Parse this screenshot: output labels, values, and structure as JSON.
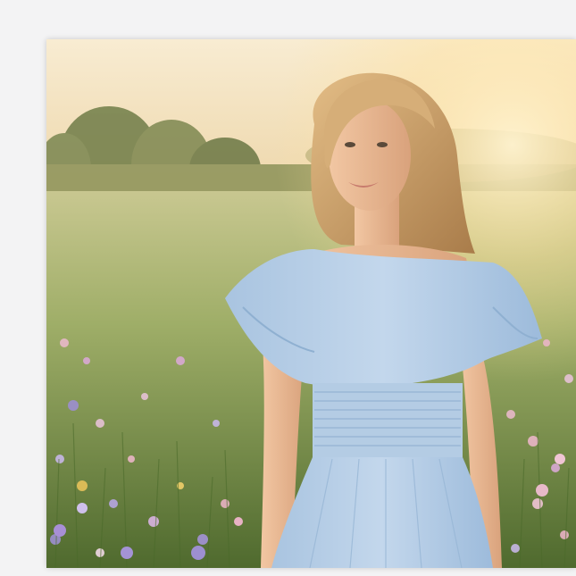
{
  "photo": {
    "subject": "woman-in-blue-dress",
    "scene": "wildflower-meadow-at-sunset"
  },
  "colors": {
    "sky_top": "#f7e8c8",
    "sky_bottom": "#e9d1a0",
    "sun_glow": "#ffe7a8",
    "trees": "#5d6b3c",
    "meadow_far": "#c4c48a",
    "meadow_near": "#5f7a3a",
    "dress": "#b7cfe6",
    "dress_shadow": "#8fb0d1",
    "skin": "#e9b995",
    "hair": "#caa06c"
  }
}
